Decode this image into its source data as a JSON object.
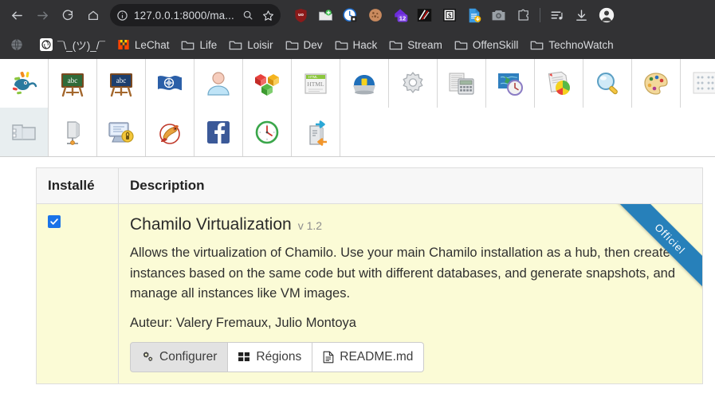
{
  "browser": {
    "nav": {
      "back_label": "Back",
      "forward_label": "Forward",
      "reload_label": "Reload",
      "home_label": "Home"
    },
    "urlbar": {
      "url": "127.0.0.1:8000/ma...",
      "site_info_icon": "info-circle-icon",
      "search_icon": "search-icon",
      "bookmark_icon": "star-icon"
    },
    "extensions": [
      {
        "name": "ublock-origin-icon",
        "badge": ""
      },
      {
        "name": "save-to-folder-icon",
        "badge": ""
      },
      {
        "name": "privacy-clock-icon",
        "badge": ""
      },
      {
        "name": "cookie-manager-icon",
        "badge": ""
      },
      {
        "name": "purple-home-icon",
        "badge": "12"
      },
      {
        "name": "dark-reader-icon",
        "badge": ""
      },
      {
        "name": "currency-converter-icon",
        "badge": ""
      },
      {
        "name": "document-download-icon",
        "badge": ""
      },
      {
        "name": "screenshot-camera-icon",
        "badge": ""
      },
      {
        "name": "extensions-puzzle-icon",
        "badge": ""
      }
    ],
    "actions": [
      {
        "name": "playlist-icon"
      },
      {
        "name": "downloads-icon"
      },
      {
        "name": "account-avatar-icon"
      }
    ]
  },
  "bookmarks": [
    {
      "label": "",
      "icon": "globe-icon"
    },
    {
      "label": "¯\\_(ツ)_/¯",
      "icon": "chatgpt-icon"
    },
    {
      "label": "LeChat",
      "icon": "mistral-icon"
    },
    {
      "label": "Life",
      "icon": "folder-icon"
    },
    {
      "label": "Loisir",
      "icon": "folder-icon"
    },
    {
      "label": "Dev",
      "icon": "folder-icon"
    },
    {
      "label": "Hack",
      "icon": "folder-icon"
    },
    {
      "label": "Stream",
      "icon": "folder-icon"
    },
    {
      "label": "OffenSkill",
      "icon": "folder-icon"
    },
    {
      "label": "TechnoWatch",
      "icon": "folder-icon"
    }
  ],
  "icon_grid": {
    "row1": [
      "chamilo-chameleon-icon",
      "green-blackboard-abc-icon",
      "blue-blackboard-abc-icon",
      "un-flag-icon",
      "user-profile-icon",
      "colored-blocks-icon",
      "html-page-icon",
      "blue-dome-building-icon",
      "gear-settings-icon",
      "calculator-icon",
      "map-clock-icon",
      "reports-piechart-icon",
      "magnifier-search-icon",
      "palette-themes-icon",
      "dotted-grid-icon"
    ],
    "row2": [
      "virtualization-folder-icon",
      "server-node-icon",
      "secure-computer-icon",
      "dragon-icon",
      "facebook-icon",
      "clock-icon",
      "server-migration-icon"
    ]
  },
  "table": {
    "headers": {
      "installed": "Installé",
      "description": "Description"
    },
    "row": {
      "installed_checked": true,
      "title": "Chamilo Virtualization",
      "version": "v 1.2",
      "description": "Allows the virtualization of Chamilo. Use your main Chamilo installation as a hub, then create instances based on the same code but with different databases, and generate snapshots, and manage all instances like VM images.",
      "author": "Auteur: Valery Fremaux, Julio Montoya",
      "ribbon": "Officiel",
      "buttons": [
        {
          "label": "Configurer",
          "icon": "gears-icon"
        },
        {
          "label": "Régions",
          "icon": "grid-blocks-icon"
        },
        {
          "label": "README.md",
          "icon": "document-file-icon"
        }
      ]
    }
  },
  "colors": {
    "chrome_bg": "#323234",
    "urlbar_bg": "#1e1e20",
    "row_highlight": "#fbfbd6",
    "ribbon_blue": "#2780ba",
    "checkbox_blue": "#1a73e8",
    "header_bg": "#f7f7f7"
  }
}
